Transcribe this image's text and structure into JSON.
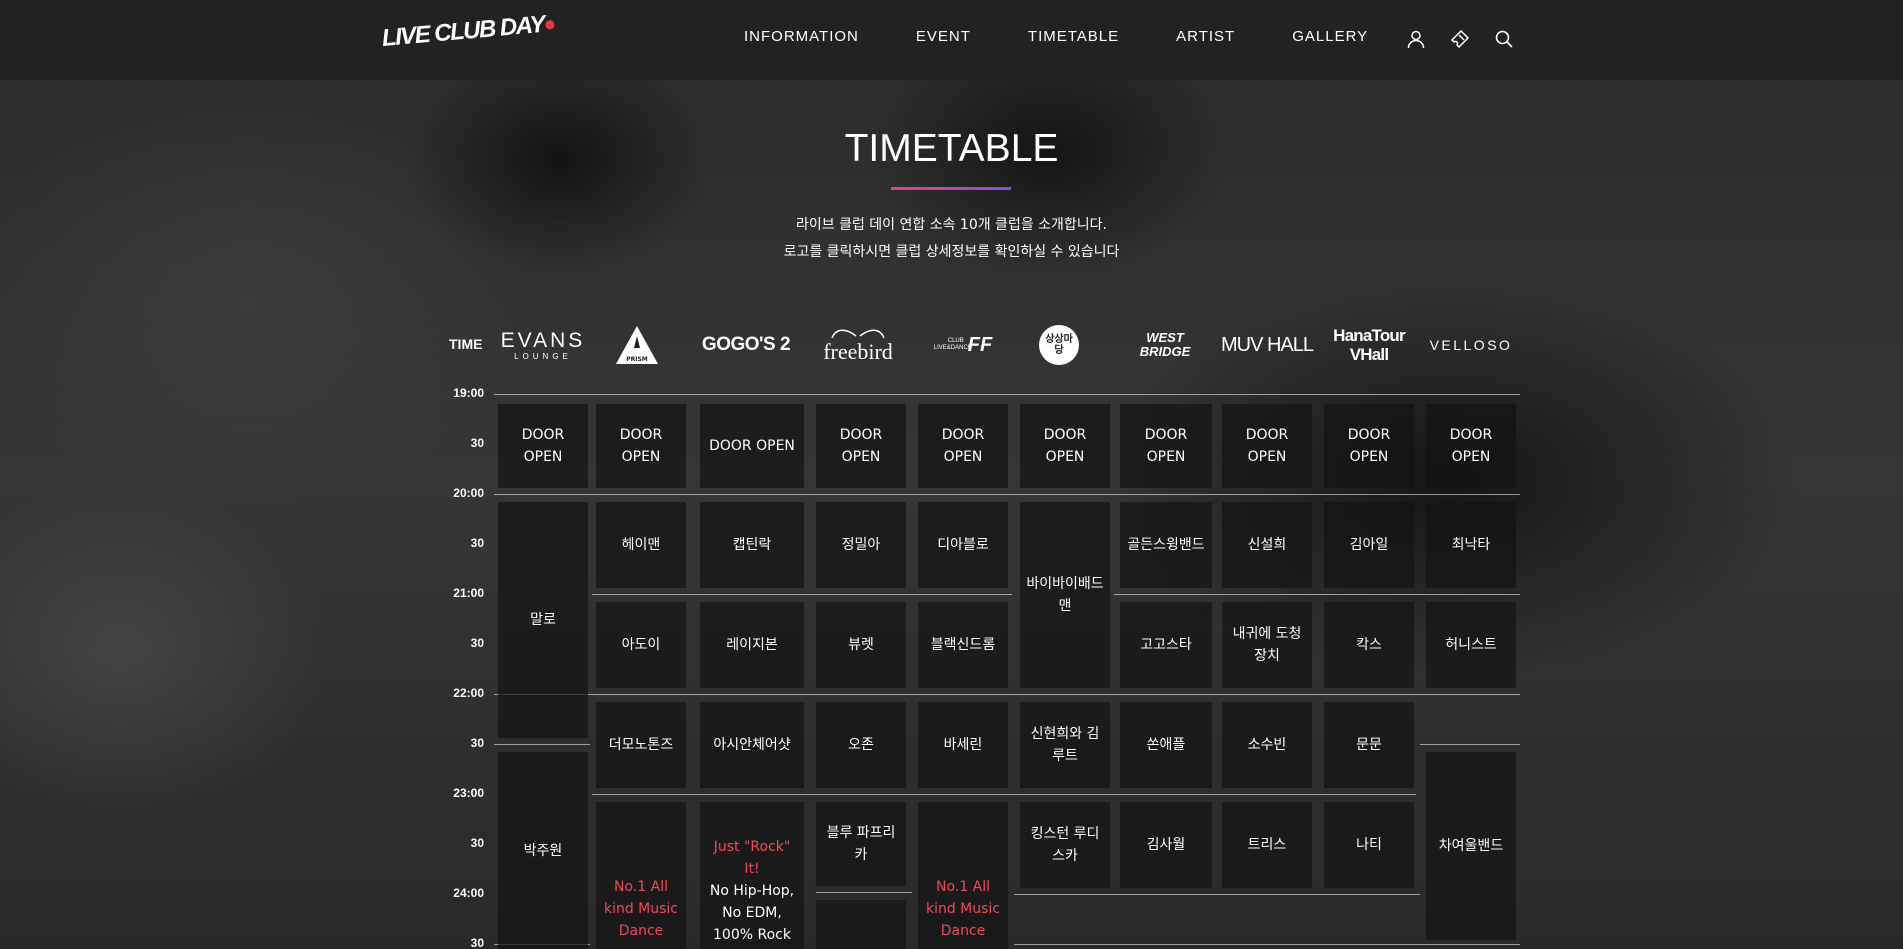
{
  "header": {
    "logo_text": "LIVE CLUB DAY",
    "nav": [
      "INFORMATION",
      "EVENT",
      "TIMETABLE",
      "ARTIST",
      "GALLERY"
    ],
    "icons": [
      "user-icon",
      "ticket-icon",
      "search-icon"
    ]
  },
  "page": {
    "title": "TIMETABLE",
    "intro_line1": "라이브 클럽 데이 연합 소속 10개 클럽을 소개합니다.",
    "intro_line2": "로고를 클릭하시면 클럽 상세정보를 확인하실 수 있습니다"
  },
  "timetable": {
    "time_header": "TIME",
    "clubs": [
      {
        "main": "EVANS",
        "sub": "LOUNGE"
      },
      {
        "main": "PRISM",
        "sub": ""
      },
      {
        "main": "GOGO'S 2",
        "sub": ""
      },
      {
        "main": "freebird",
        "sub": ""
      },
      {
        "main": "FF",
        "sub": "CLUB LIVE&DANCE"
      },
      {
        "main": "상상마당",
        "sub": ""
      },
      {
        "main": "WEST BRIDGE",
        "sub": ""
      },
      {
        "main": "MUV HALL",
        "sub": ""
      },
      {
        "main": "HanaTour VHall",
        "sub": ""
      },
      {
        "main": "VELLOSO",
        "sub": ""
      }
    ],
    "times": [
      "19:00",
      "30",
      "20:00",
      "30",
      "21:00",
      "30",
      "22:00",
      "30",
      "23:00",
      "30",
      "24:00",
      "30"
    ],
    "door_open": "DOOR OPEN",
    "performers": {
      "evans": [
        "말로",
        "박주원"
      ],
      "prism": [
        "헤이맨",
        "아도이",
        "더모노톤즈"
      ],
      "prism_note": "No.1 All kind Music Dance",
      "gogos": [
        "캡틴락",
        "레이지본",
        "아시안체어샷"
      ],
      "gogos_note_red": "Just \"Rock\" It!",
      "gogos_note": "No Hip-Hop, No EDM, 100% Rock",
      "freebird": [
        "정밀아",
        "뷰렛",
        "오존",
        "블루 파프리카"
      ],
      "ff": [
        "디아블로",
        "블랙신드롬",
        "바세린"
      ],
      "ff_note": "No.1 All kind Music Dance",
      "sangsang": [
        "바이바이배드맨",
        "신현희와 김루트",
        "킹스턴 루디스카"
      ],
      "westbridge": [
        "골든스윙밴드",
        "고고스타",
        "쏜애플",
        "김사월"
      ],
      "muvhall": [
        "신설희",
        "내귀에 도청장치",
        "소수빈",
        "트리스"
      ],
      "hanatour": [
        "김아일",
        "칵스",
        "문문",
        "나티"
      ],
      "velloso": [
        "최낙타",
        "허니스트",
        "차여울밴드"
      ]
    }
  }
}
